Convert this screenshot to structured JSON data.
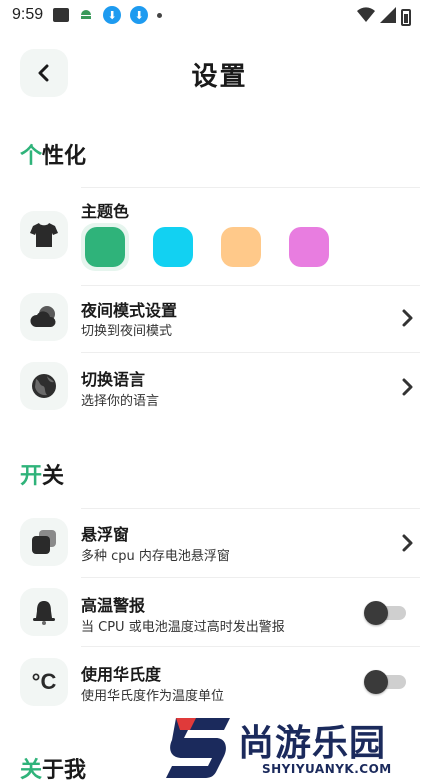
{
  "status_bar": {
    "time": "9:59"
  },
  "header": {
    "title": "设置"
  },
  "sections": {
    "personalize": {
      "accent": "个",
      "rest": "性化"
    },
    "switches": {
      "accent": "开",
      "rest": "关"
    },
    "about": {
      "accent": "关",
      "rest": "于我"
    }
  },
  "theme": {
    "title": "主题色",
    "colors": [
      "#2fb37a",
      "#12d1f2",
      "#ffc98a",
      "#e87de0"
    ],
    "selected_index": 0
  },
  "night_mode": {
    "title": "夜间模式设置",
    "subtitle": "切换到夜间模式"
  },
  "language": {
    "title": "切换语言",
    "subtitle": "选择你的语言"
  },
  "float_window": {
    "title": "悬浮窗",
    "subtitle": "多种 cpu 内存电池悬浮窗"
  },
  "temp_alert": {
    "title": "高温警报",
    "subtitle": "当 CPU 或电池温度过高时发出警报",
    "enabled": false
  },
  "fahrenheit": {
    "title": "使用华氏度",
    "subtitle": "使用华氏度作为温度单位",
    "enabled": false,
    "icon_text": "°C"
  },
  "watermark": {
    "main": "尚游乐园",
    "sub": "SHYIYUANYK.COM"
  },
  "colors": {
    "accent": "#2fb37a",
    "icon_bg": "#f2f6f4"
  }
}
